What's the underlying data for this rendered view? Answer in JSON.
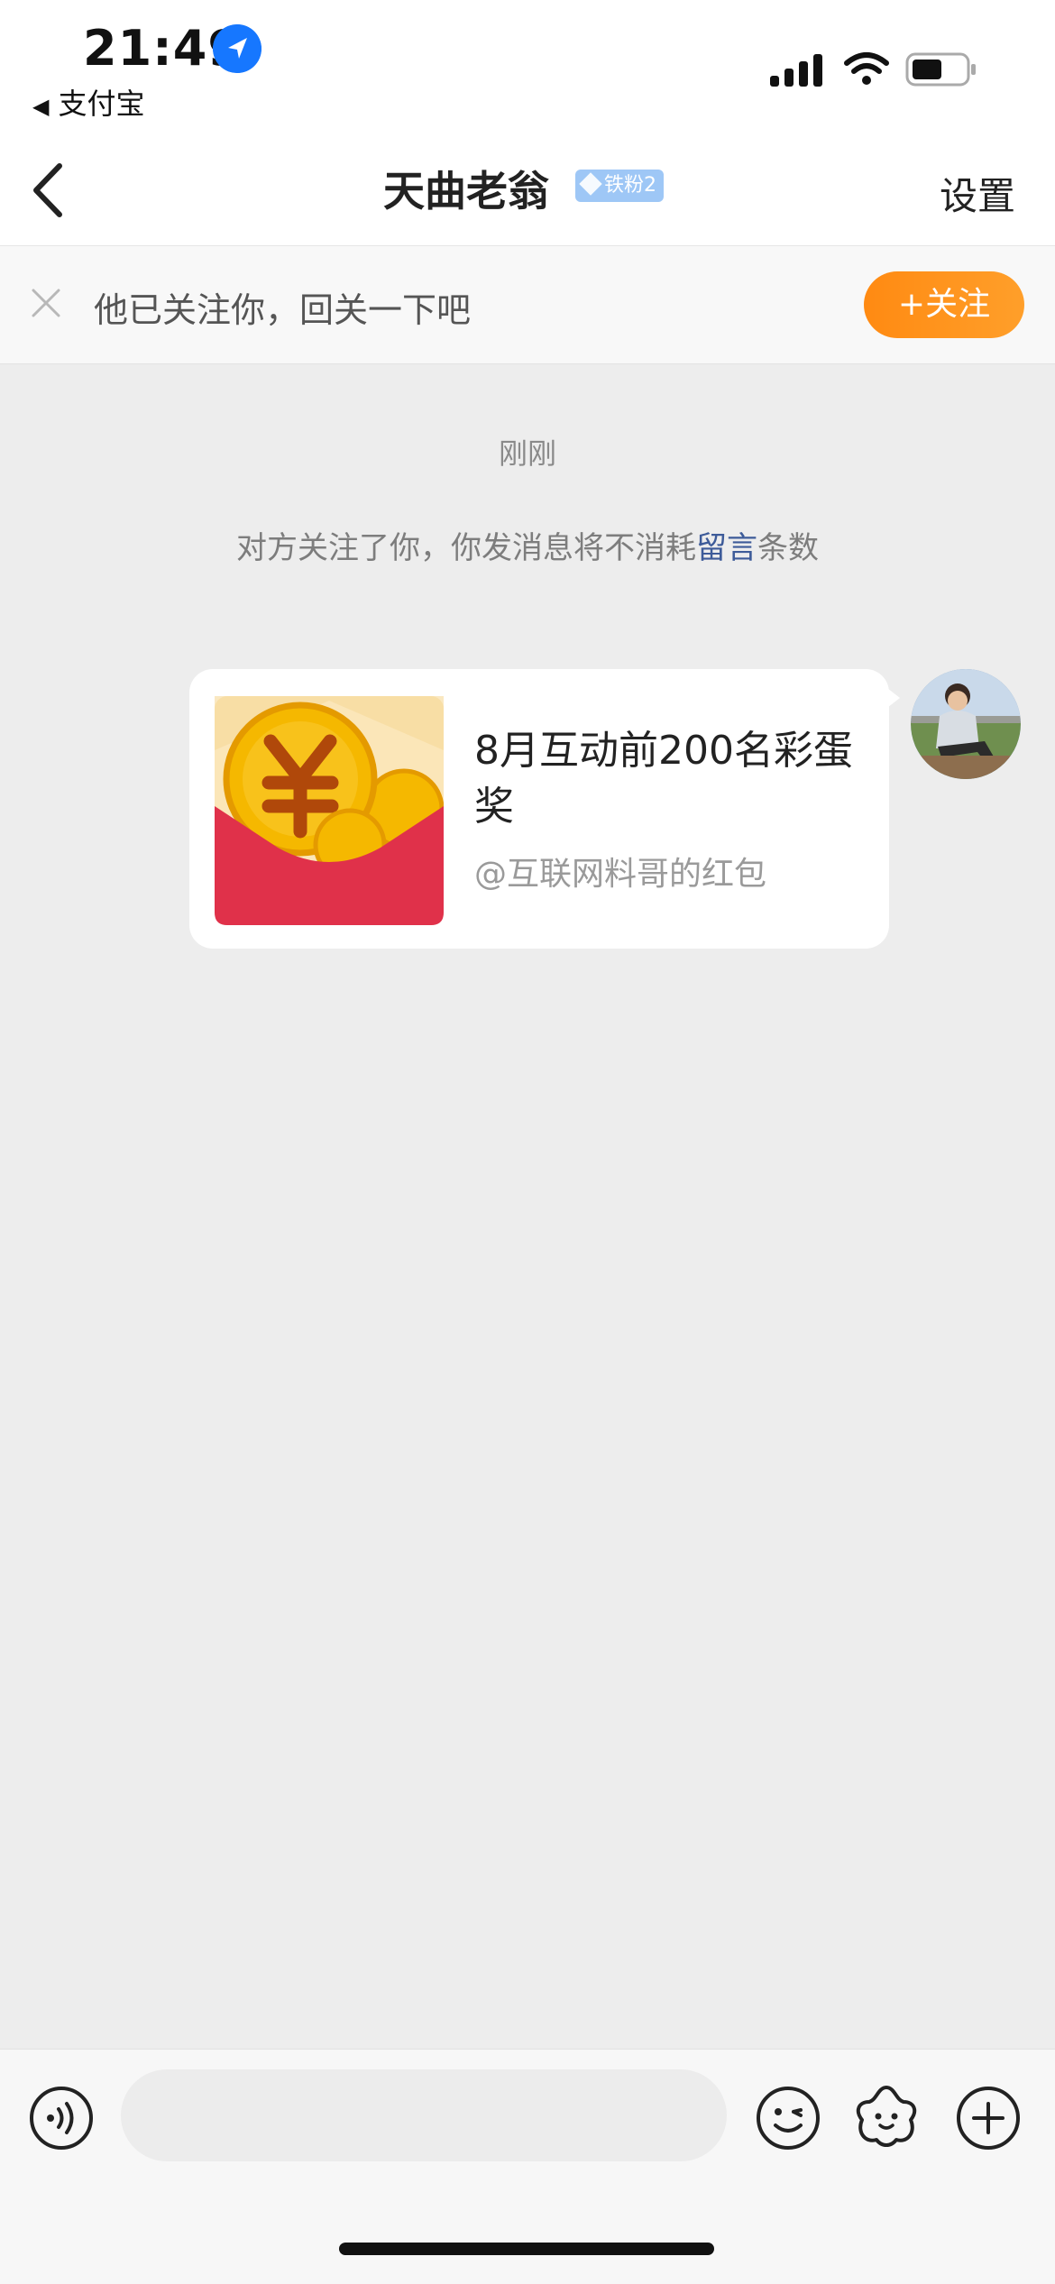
{
  "status_bar": {
    "time": "21:49",
    "back_app_label": "支付宝",
    "icons": [
      "location-arrow-icon",
      "signal-icon",
      "wifi-icon",
      "battery-icon"
    ]
  },
  "nav": {
    "title": "天曲老翁",
    "badge": "铁粉2",
    "settings": "设置"
  },
  "follow_banner": {
    "text": "他已关注你，回关一下吧",
    "button": "+关注"
  },
  "chat": {
    "timestamp": "刚刚",
    "system_message": {
      "before": "对方关注了你，你发消息将不消耗",
      "link": "留言",
      "after": "条数"
    },
    "message_card": {
      "title": "8月互动前200名彩蛋奖",
      "subtitle": "@互联网料哥的红包"
    }
  },
  "input_bar": {
    "placeholder": "",
    "icons": [
      "voice-icon",
      "emoji-icon",
      "sticker-icon",
      "plus-icon"
    ]
  },
  "colors": {
    "accent_orange": "#ff8a12",
    "link_blue": "#3d5b99",
    "badge_blue": "#9ec7f6",
    "red_packet": "#e0314a",
    "coin_gold": "#f5b800"
  }
}
